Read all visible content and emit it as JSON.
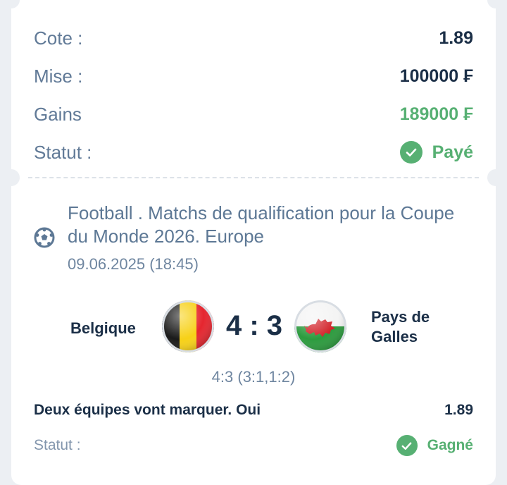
{
  "summary": {
    "odds_label": "Cote :",
    "odds_value": "1.89",
    "stake_label": "Mise :",
    "stake_value": "100000 ₣",
    "winnings_label": "Gains",
    "winnings_value": "189000 ₣",
    "status_label": "Statut :",
    "status_value": "Payé",
    "status_icon": "check-circle-icon"
  },
  "event": {
    "sport_icon": "soccer-ball-icon",
    "title": "Football . Matchs de qualification pour la Coupe du Monde 2026. Europe",
    "date": "09.06.2025 (18:45)",
    "home_team": "Belgique",
    "away_team_line1": "Pays de",
    "away_team_line2": "Galles",
    "score": "4 : 3",
    "detailed_score": "4:3 (3:1,1:2)",
    "home_flag": "belgium-flag",
    "away_flag": "wales-flag"
  },
  "bet": {
    "name": "Deux équipes vont marquer. Oui",
    "odds": "1.89",
    "status_label": "Statut :",
    "status_value": "Gagné",
    "status_icon": "check-circle-icon"
  },
  "colors": {
    "accent_green": "#57b073",
    "text_dark": "#1b2f47",
    "text_muted": "#617a97",
    "background": "#eceff3"
  }
}
